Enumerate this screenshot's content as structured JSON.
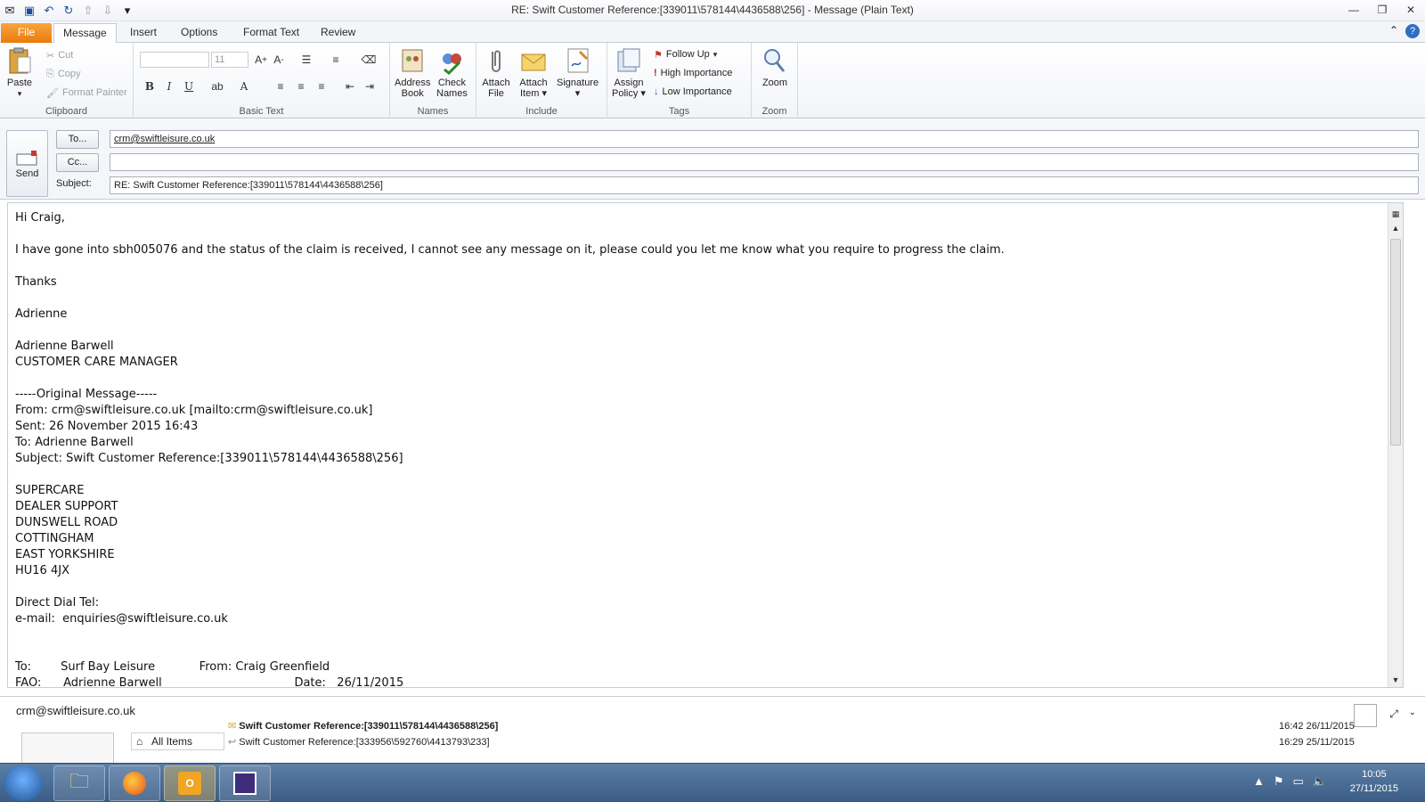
{
  "window": {
    "title": "RE: Swift Customer Reference:[339011\\578144\\4436588\\256]  -  Message (Plain Text)"
  },
  "tabs": [
    "File",
    "Message",
    "Insert",
    "Options",
    "Format Text",
    "Review"
  ],
  "ribbon": {
    "clipboard": {
      "label": "Clipboard",
      "paste": "Paste",
      "cut": "Cut",
      "copy": "Copy",
      "format_painter": "Format Painter"
    },
    "basic_text": {
      "label": "Basic Text",
      "font_size": "11"
    },
    "names": {
      "label": "Names",
      "address_book_1": "Address",
      "address_book_2": "Book",
      "check_names_1": "Check",
      "check_names_2": "Names"
    },
    "include": {
      "label": "Include",
      "attach_file_1": "Attach",
      "attach_file_2": "File",
      "attach_item_1": "Attach",
      "attach_item_2": "Item",
      "signature": "Signature"
    },
    "tags": {
      "label": "Tags",
      "assign_policy_1": "Assign",
      "assign_policy_2": "Policy",
      "follow_up": "Follow Up",
      "high_importance": "High Importance",
      "low_importance": "Low Importance"
    },
    "zoom": {
      "label": "Zoom",
      "zoom": "Zoom"
    }
  },
  "header": {
    "send": "Send",
    "to_button": "To...",
    "cc_button": "Cc...",
    "subject_label": "Subject:",
    "to_value": "crm@swiftleisure.co.uk",
    "cc_value": "",
    "subject_value": "RE: Swift Customer Reference:[339011\\578144\\4436588\\256]"
  },
  "body": {
    "text": "Hi Craig,\n\nI have gone into sbh005076 and the status of the claim is received, I cannot see any message on it, please could you let me know what you require to progress the claim.\n\nThanks\n\nAdrienne\n\nAdrienne Barwell\nCUSTOMER CARE MANAGER\n\n-----Original Message-----\nFrom: crm@swiftleisure.co.uk [mailto:crm@swiftleisure.co.uk]\nSent: 26 November 2015 16:43\nTo: Adrienne Barwell\nSubject: Swift Customer Reference:[339011\\578144\\4436588\\256]\n\nSUPERCARE\nDEALER SUPPORT\nDUNSWELL ROAD\nCOTTINGHAM\nEAST YORKSHIRE\nHU16 4JX\n\nDirect Dial Tel:\ne-mail:  enquiries@swiftleisure.co.uk\n\n\nTo:        Surf Bay Leisure            From: Craig Greenfield\nFAO:      Adrienne Barwell                                    Date:   26/11/2015"
  },
  "people_pane": {
    "email": "crm@swiftleisure.co.uk",
    "all_items": "All Items",
    "items": [
      {
        "subject": "Swift Customer Reference:[339011\\578144\\4436588\\256]",
        "time": "16:42  26/11/2015"
      },
      {
        "subject": "Swift Customer Reference:[333956\\592760\\4413793\\233]",
        "time": "16:29  25/11/2015"
      }
    ]
  },
  "taskbar": {
    "time": "10:05",
    "date": "27/11/2015"
  }
}
